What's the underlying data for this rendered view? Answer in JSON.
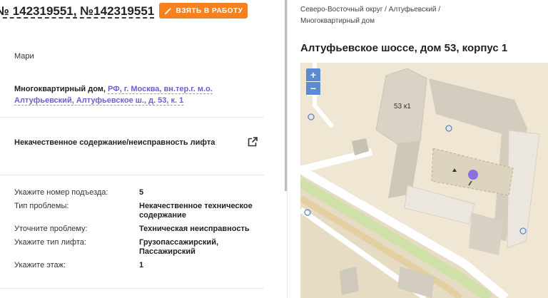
{
  "request": {
    "title": "№ 142319551, №142319551",
    "take_button": "ВЗЯТЬ В РАБОТУ",
    "user_name": "Мари",
    "address_prefix": "Многоквартирный дом,",
    "address_link": "РФ, г. Москва, вн.тер.г. м.о. Алтуфьевский, Алтуфьевское ш., д. 53, к. 1",
    "problem": "Некачественное содержание/неисправность лифта"
  },
  "fields": [
    {
      "label": "Укажите номер подъезда:",
      "value": "5"
    },
    {
      "label": "Тип проблемы:",
      "value": "Некачественное техническое содержание"
    },
    {
      "label": "Уточните проблему:",
      "value": "Техническая неисправность"
    },
    {
      "label": "Укажите тип лифта:",
      "value": "Грузопассажирский, Пассажирский"
    },
    {
      "label": "Укажите этаж:",
      "value": "1"
    }
  ],
  "location": {
    "breadcrumbs": "Северо-Восточный округ / Алтуфьевский / Многоквартирный дом",
    "title": "Алтуфьевское шоссе, дом 53, корпус 1"
  },
  "map": {
    "zoom_in": "+",
    "zoom_out": "−",
    "building_label": "53 к1"
  },
  "colors": {
    "accent": "#f5821f",
    "link": "#6b5fd3",
    "marker": "#8c6ee0",
    "zoom": "#5b8bd1"
  }
}
